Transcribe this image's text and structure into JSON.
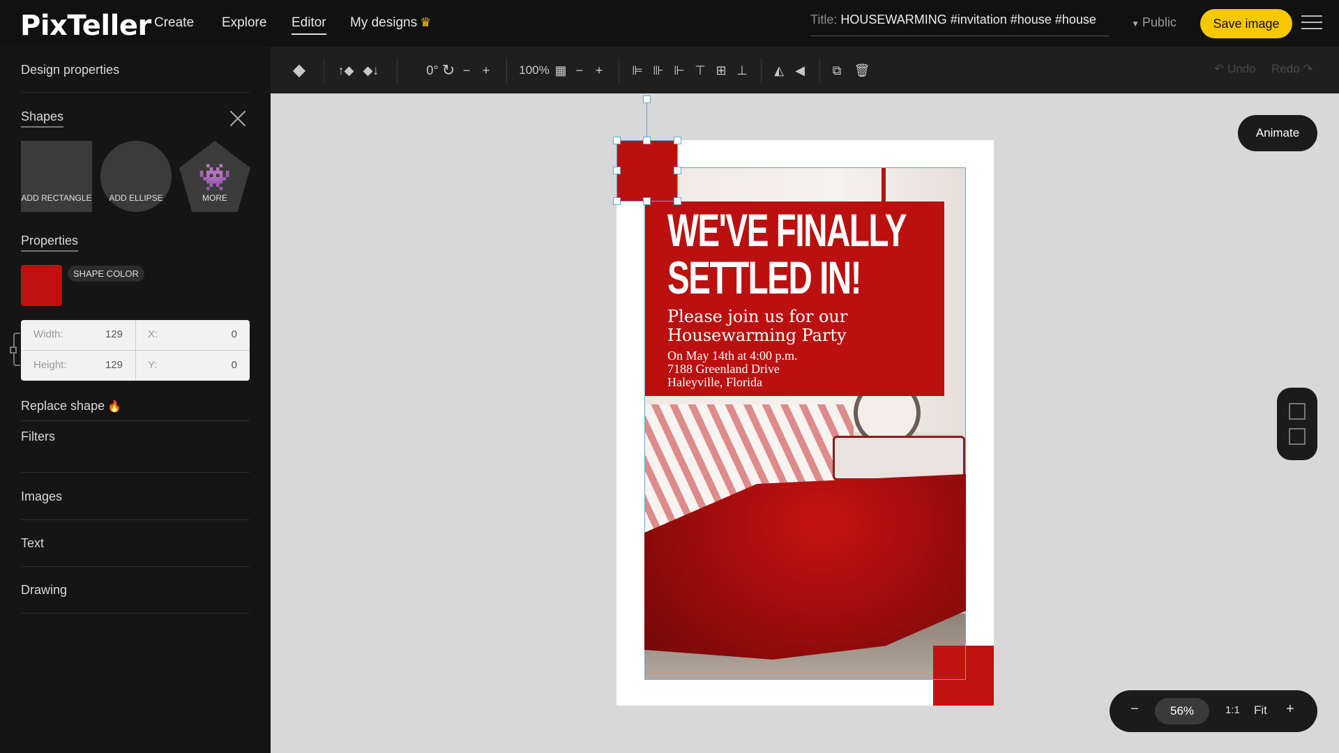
{
  "nav": {
    "logo": "PixTeller",
    "items": [
      "Create",
      "Explore",
      "Editor",
      "My designs"
    ],
    "title_label": "Title:",
    "title_value": "HOUSEWARMING #invitation #house #house",
    "visibility": "Public",
    "save_label": "Save image"
  },
  "sidebar": {
    "design_properties": "Design properties",
    "shapes_heading": "Shapes",
    "add_rectangle": "ADD RECTANGLE",
    "add_ellipse": "ADD ELLIPSE",
    "more": "MORE",
    "properties_heading": "Properties",
    "shape_color_label": "SHAPE COLOR",
    "shape_color": "#c01010",
    "width_label": "Width:",
    "width_value": "129",
    "height_label": "Height:",
    "height_value": "129",
    "x_label": "X:",
    "x_value": "0",
    "y_label": "Y:",
    "y_value": "0",
    "replace_shape": "Replace shape",
    "filters": "Filters",
    "images": "Images",
    "text": "Text",
    "drawing": "Drawing"
  },
  "toolbar": {
    "rotation": "0°",
    "opacity": "100%",
    "undo": "Undo",
    "redo": "Redo"
  },
  "canvas": {
    "animate_label": "Animate",
    "zoom_value": "56%",
    "ratio_label": "1:1",
    "fit_label": "Fit"
  },
  "design": {
    "headline_1": "WE'VE FINALLY",
    "headline_2": "SETTLED IN!",
    "subline_1": "Please join us for our",
    "subline_2": "Housewarming Party",
    "detail_1": "On May 14th at 4:00 p.m.",
    "detail_2": "7188 Greenland Drive",
    "detail_3": "Haleyville, Florida",
    "accent_color": "#bb1010"
  },
  "colors": {
    "save_button": "#f7c800",
    "selection": "#5fa8d8"
  }
}
